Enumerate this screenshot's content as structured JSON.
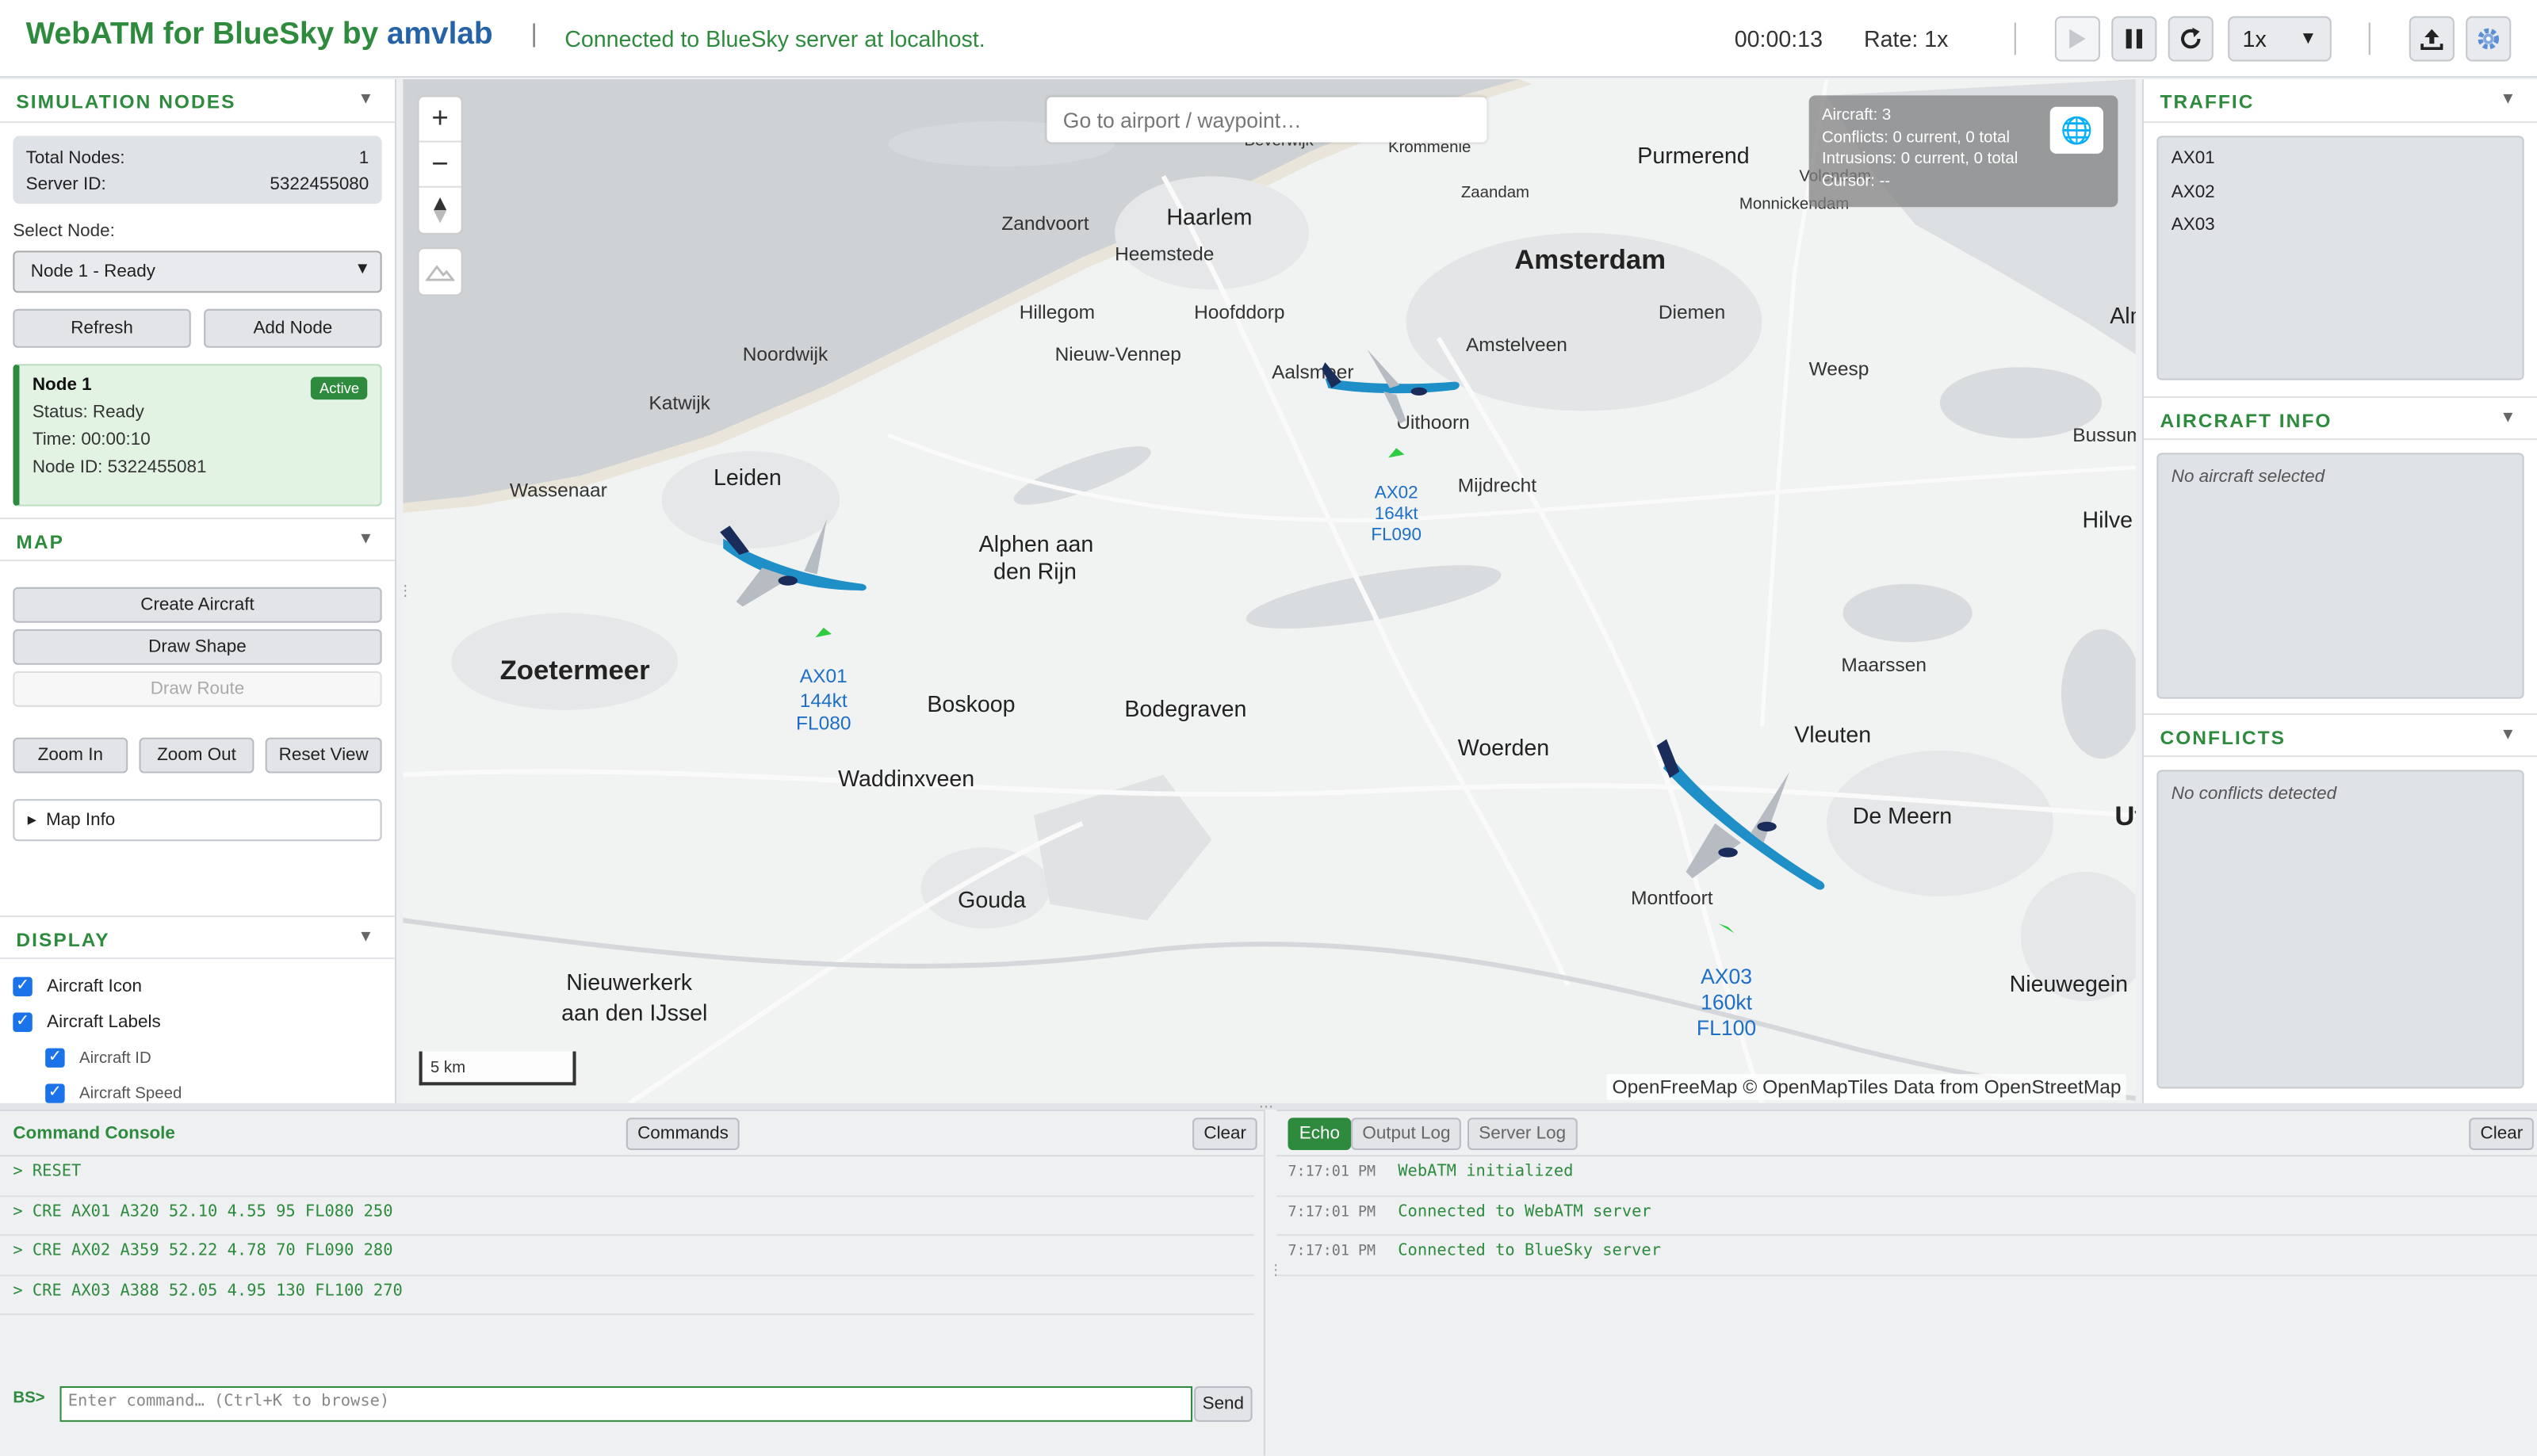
{
  "header": {
    "brand_main": "WebATM for BlueSky by",
    "brand_lab": "amvlab",
    "separator": "|",
    "status": "Connected to BlueSky server at localhost.",
    "sim_time": "00:00:13",
    "rate": "Rate: 1x",
    "speed_value": "1x"
  },
  "left": {
    "sim_nodes": {
      "title": "SIMULATION NODES",
      "total_label": "Total Nodes:",
      "total_value": "1",
      "server_label": "Server ID:",
      "server_value": "5322455080",
      "select_label": "Select Node:",
      "select_value": "Node 1 - Ready",
      "refresh": "Refresh",
      "add_node": "Add Node",
      "node_card": {
        "name": "Node 1",
        "badge": "Active",
        "status": "Status: Ready",
        "time": "Time: 00:00:10",
        "node_id": "Node ID: 5322455081"
      }
    },
    "map": {
      "title": "MAP",
      "create_aircraft": "Create Aircraft",
      "draw_shape": "Draw Shape",
      "draw_route": "Draw Route",
      "zoom_in": "Zoom In",
      "zoom_out": "Zoom Out",
      "reset_view": "Reset View",
      "map_info": "Map Info"
    },
    "display": {
      "title": "DISPLAY",
      "aircraft_icon": "Aircraft Icon",
      "aircraft_labels": "Aircraft Labels",
      "aircraft_id": "Aircraft ID",
      "aircraft_speed": "Aircraft Speed"
    }
  },
  "map": {
    "search_placeholder": "Go to airport / waypoint…",
    "overlay": {
      "aircraft": "Aircraft: 3",
      "conflicts": "Conflicts: 0 current, 0 total",
      "intrusions": "Intrusions: 0 current, 0 total",
      "cursor": "Cursor: --"
    },
    "places": [
      {
        "name": "Amsterdam",
        "size": "big"
      },
      {
        "name": "Haarlem",
        "size": "med"
      },
      {
        "name": "Leiden",
        "size": "med"
      },
      {
        "name": "Zoetermeer",
        "size": "big"
      },
      {
        "name": "Purmerend",
        "size": "med"
      },
      {
        "name": "Zandvoort",
        "size": "sm"
      },
      {
        "name": "Heemstede",
        "size": "sm"
      },
      {
        "name": "Hillegom",
        "size": "sm"
      },
      {
        "name": "Hoofddorp",
        "size": "sm"
      },
      {
        "name": "Noordwijk",
        "size": "sm"
      },
      {
        "name": "Nieuw-Vennep",
        "size": "sm"
      },
      {
        "name": "Katwijk",
        "size": "sm"
      },
      {
        "name": "Wassenaar",
        "size": "sm"
      },
      {
        "name": "Alphen aan",
        "size": "med"
      },
      {
        "name": "den Rijn",
        "size": "med"
      },
      {
        "name": "Boskoop",
        "size": "med"
      },
      {
        "name": "Bodegraven",
        "size": "med"
      },
      {
        "name": "Waddinxveen",
        "size": "med"
      },
      {
        "name": "Gouda",
        "size": "med"
      },
      {
        "name": "Nieuwerkerk",
        "size": "med"
      },
      {
        "name": "aan den IJssel",
        "size": "med"
      },
      {
        "name": "Woerden",
        "size": "med"
      },
      {
        "name": "Montfoort",
        "size": "sm"
      },
      {
        "name": "Vleuten",
        "size": "med"
      },
      {
        "name": "De Meern",
        "size": "med"
      },
      {
        "name": "Maarssen",
        "size": "sm"
      },
      {
        "name": "Nieuwegein",
        "size": "med"
      },
      {
        "name": "Utre",
        "size": "big"
      },
      {
        "name": "Hilve",
        "size": "med"
      },
      {
        "name": "Bussum",
        "size": "sm"
      },
      {
        "name": "Weesp",
        "size": "sm"
      },
      {
        "name": "Diemen",
        "size": "sm"
      },
      {
        "name": "Amstelveen",
        "size": "sm"
      },
      {
        "name": "Aalsmeer",
        "size": "sm"
      },
      {
        "name": "Uithoorn",
        "size": "sm"
      },
      {
        "name": "Mijdrecht",
        "size": "sm"
      },
      {
        "name": "Zaandam",
        "size": "xs"
      },
      {
        "name": "Krommenie",
        "size": "xs"
      },
      {
        "name": "Beverwijk",
        "size": "xs"
      },
      {
        "name": "Volendam",
        "size": "xs"
      },
      {
        "name": "Monnickendam",
        "size": "xs"
      },
      {
        "name": "Alme",
        "size": "med"
      }
    ],
    "aircraft": [
      {
        "id": "AX01",
        "speed": "144kt",
        "alt": "FL080"
      },
      {
        "id": "AX02",
        "speed": "164kt",
        "alt": "FL090"
      },
      {
        "id": "AX03",
        "speed": "160kt",
        "alt": "FL100"
      }
    ],
    "scale": "5 km",
    "attribution": "OpenFreeMap © OpenMapTiles Data from OpenStreetMap"
  },
  "right": {
    "traffic_title": "TRAFFIC",
    "traffic": [
      "AX01",
      "AX02",
      "AX03"
    ],
    "aircraft_info_title": "AIRCRAFT INFO",
    "aircraft_info_empty": "No aircraft selected",
    "conflicts_title": "CONFLICTS",
    "conflicts_empty": "No conflicts detected"
  },
  "console": {
    "title": "Command Console",
    "commands_btn": "Commands",
    "clear": "Clear",
    "lines": [
      "> RESET",
      "> CRE AX01 A320 52.10 4.55 95 FL080 250",
      "> CRE AX02 A359 52.22 4.78 70 FL090 280",
      "> CRE AX03 A388 52.05 4.95 130 FL100 270"
    ],
    "prompt": "BS>",
    "input_placeholder": "Enter command… (Ctrl+K to browse)",
    "send": "Send"
  },
  "logs": {
    "tabs": [
      "Echo",
      "Output Log",
      "Server Log"
    ],
    "clear": "Clear",
    "entries": [
      {
        "time": "7:17:01 PM",
        "msg": "WebATM initialized"
      },
      {
        "time": "7:17:01 PM",
        "msg": "Connected to WebATM server"
      },
      {
        "time": "7:17:01 PM",
        "msg": "Connected to BlueSky server"
      }
    ]
  },
  "colors": {
    "accent_green": "#2e8b3e",
    "brand_blue": "#2563a6",
    "aircraft_label_blue": "#1e6fc6",
    "map_background": "#f1f2f2"
  }
}
